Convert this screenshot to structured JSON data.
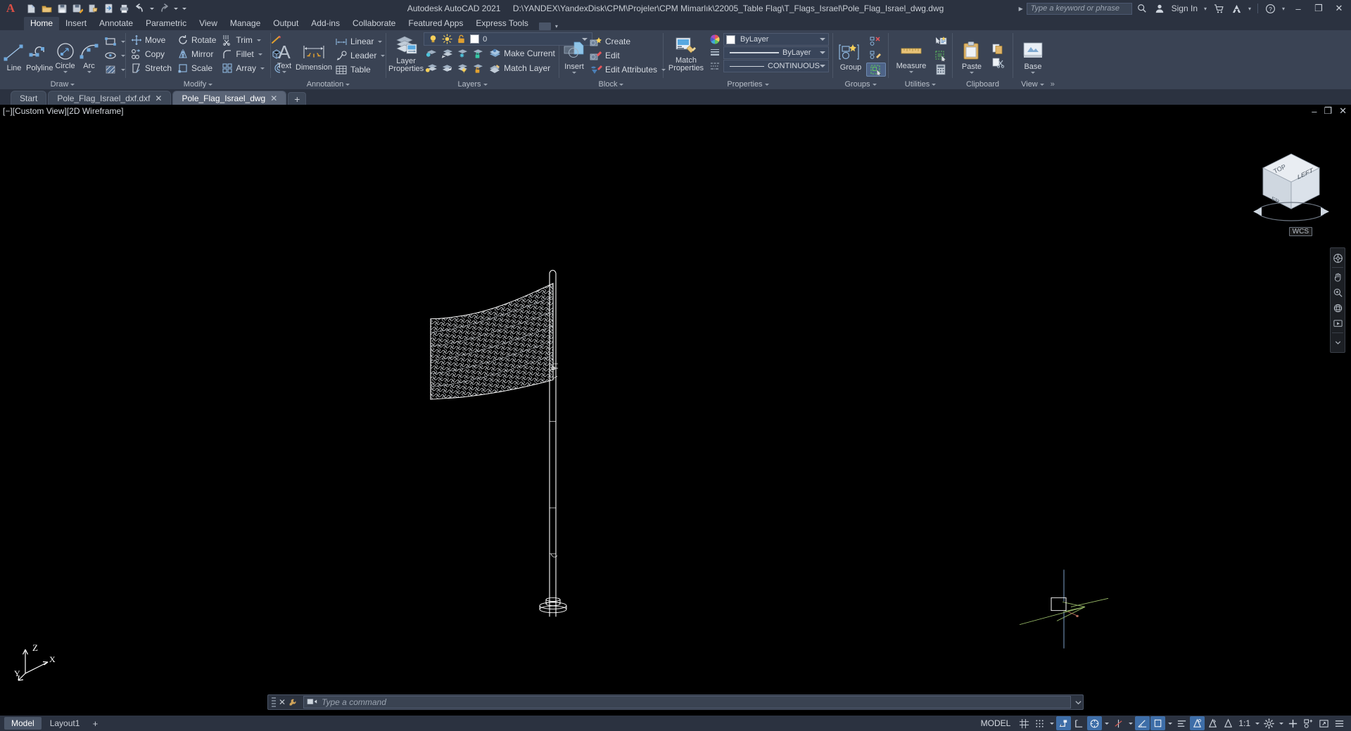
{
  "titlebar": {
    "app_title": "Autodesk AutoCAD 2021",
    "file_path": "D:\\YANDEX\\YandexDisk\\CPM\\Projeler\\CPM Mimarlık\\22005_Table Flag\\T_Flags_Israel\\Pole_Flag_Israel_dwg.dwg",
    "search_placeholder": "Type a keyword or phrase",
    "sign_in": "Sign In",
    "quick_access": [
      {
        "name": "new-file-icon",
        "label": "New"
      },
      {
        "name": "open-file-icon",
        "label": "Open"
      },
      {
        "name": "save-icon",
        "label": "Save"
      },
      {
        "name": "save-as-icon",
        "label": "Save As"
      },
      {
        "name": "export-icon",
        "label": "Export"
      },
      {
        "name": "cloud-sync-icon",
        "label": "Sync"
      },
      {
        "name": "print-icon",
        "label": "Plot"
      },
      {
        "name": "undo-icon",
        "label": "Undo"
      },
      {
        "name": "redo-icon",
        "label": "Redo"
      }
    ],
    "window_controls": {
      "minimize": "–",
      "restore": "❐",
      "close": "✕"
    }
  },
  "ribbon": {
    "tabs": [
      {
        "label": "Home",
        "active": true
      },
      {
        "label": "Insert",
        "active": false
      },
      {
        "label": "Annotate",
        "active": false
      },
      {
        "label": "Parametric",
        "active": false
      },
      {
        "label": "View",
        "active": false
      },
      {
        "label": "Manage",
        "active": false
      },
      {
        "label": "Output",
        "active": false
      },
      {
        "label": "Add-ins",
        "active": false
      },
      {
        "label": "Collaborate",
        "active": false
      },
      {
        "label": "Featured Apps",
        "active": false
      },
      {
        "label": "Express Tools",
        "active": false
      }
    ],
    "panels": {
      "draw": {
        "title": "Draw",
        "big": [
          {
            "label": "Line",
            "icon": "line-icon"
          },
          {
            "label": "Polyline",
            "icon": "polyline-icon"
          },
          {
            "label": "Circle",
            "icon": "circle-icon",
            "caret": true
          },
          {
            "label": "Arc",
            "icon": "arc-icon",
            "caret": true
          }
        ],
        "small": [
          {
            "label": "",
            "icon": "rectangle-icon",
            "caret": true
          },
          {
            "label": "",
            "icon": "ellipse-icon",
            "caret": true
          },
          {
            "label": "",
            "icon": "hatch-icon",
            "caret": true
          }
        ]
      },
      "modify": {
        "title": "Modify",
        "col1": [
          {
            "label": "Move",
            "icon": "move-icon"
          },
          {
            "label": "Copy",
            "icon": "copy-icon"
          },
          {
            "label": "Stretch",
            "icon": "stretch-icon"
          }
        ],
        "col2": [
          {
            "label": "Rotate",
            "icon": "rotate-icon"
          },
          {
            "label": "Mirror",
            "icon": "mirror-icon"
          },
          {
            "label": "Scale",
            "icon": "scale-icon"
          }
        ],
        "col3": [
          {
            "label": "Trim",
            "icon": "trim-icon",
            "caret": true
          },
          {
            "label": "Fillet",
            "icon": "fillet-icon",
            "caret": true
          },
          {
            "label": "Array",
            "icon": "array-icon",
            "caret": true
          }
        ],
        "col4": [
          {
            "label": "",
            "icon": "explode-icon"
          },
          {
            "label": "",
            "icon": "3d-solid-icon"
          },
          {
            "label": "",
            "icon": "offset-icon"
          }
        ]
      },
      "annotation": {
        "title": "Annotation",
        "big": [
          {
            "label": "Text",
            "icon": "text-icon",
            "caret": true
          },
          {
            "label": "Dimension",
            "icon": "dimension-icon"
          }
        ],
        "small": [
          {
            "label": "Linear",
            "icon": "linear-dim-icon",
            "caret": true
          },
          {
            "label": "Leader",
            "icon": "leader-icon",
            "caret": true
          },
          {
            "label": "Table",
            "icon": "table-icon"
          }
        ]
      },
      "layers": {
        "title": "Layers",
        "big_label": "Layer\nProperties",
        "big_line1": "Layer",
        "big_line2": "Properties",
        "current_layer": "0",
        "make_current": "Make Current",
        "match_layer": "Match Layer",
        "state_icons": [
          "lightbulb-on-icon",
          "sun-icon",
          "unlock-icon"
        ],
        "row_icons_1": [
          "layer-off-icon",
          "layer-isolate-icon",
          "layer-freeze-icon",
          "layer-lock-icon"
        ],
        "row_icons_2": [
          "layer-turn-on-icon",
          "layer-unisolate-icon",
          "layer-thaw-icon",
          "layer-unlock-icon"
        ]
      },
      "block": {
        "title": "Block",
        "big": [
          {
            "label": "Insert",
            "icon": "insert-block-icon",
            "caret": true
          }
        ],
        "small": [
          {
            "label": "Create",
            "icon": "create-block-icon"
          },
          {
            "label": "Edit",
            "icon": "edit-block-icon"
          },
          {
            "label": "Edit Attributes",
            "icon": "edit-attributes-icon",
            "caret": true
          }
        ]
      },
      "properties": {
        "title": "Properties",
        "big_line1": "Match",
        "big_line2": "Properties",
        "big_icon": "match-properties-icon",
        "combos": [
          {
            "icon": "color-wheel-icon",
            "value": "ByLayer",
            "type": "color"
          },
          {
            "icon": "lineweight-icon",
            "value": "ByLayer",
            "type": "lineweight"
          },
          {
            "icon": "linetype-icon",
            "value": "CONTINUOUS",
            "type": "linetype"
          }
        ]
      },
      "groups": {
        "title": "Groups",
        "big": [
          {
            "label": "Group",
            "icon": "group-icon"
          }
        ],
        "small": [
          {
            "label": "",
            "icon": "ungroup-icon"
          },
          {
            "label": "",
            "icon": "group-edit-icon"
          },
          {
            "label": "",
            "icon": "group-selection-on-icon"
          }
        ]
      },
      "utilities": {
        "title": "Utilities",
        "big": [
          {
            "label": "Measure",
            "icon": "measure-icon",
            "caret": true
          }
        ],
        "small": [
          {
            "label": "",
            "icon": "quick-select-icon"
          },
          {
            "label": "",
            "icon": "select-all-icon"
          },
          {
            "label": "",
            "icon": "calculator-icon"
          }
        ]
      },
      "clipboard": {
        "title": "Clipboard",
        "big": [
          {
            "label": "Paste",
            "icon": "paste-icon",
            "caret": true
          }
        ],
        "small": [
          {
            "label": "",
            "icon": "copy-clip-icon"
          },
          {
            "label": "",
            "icon": "cut-clip-icon"
          }
        ]
      },
      "view": {
        "title": "View",
        "big": [
          {
            "label": "Base",
            "icon": "base-view-icon",
            "caret": true
          }
        ],
        "overflow": "»"
      }
    }
  },
  "file_tabs": [
    {
      "label": "Start",
      "active": false,
      "closable": false
    },
    {
      "label": "Pole_Flag_Israel_dxf.dxf",
      "active": false,
      "closable": true
    },
    {
      "label": "Pole_Flag_Israel_dwg",
      "active": true,
      "closable": true
    }
  ],
  "file_tab_add": "+",
  "viewport": {
    "label_minimize": "[−]",
    "label_view": "[Custom View]",
    "label_visual_style": "[2D Wireframe]",
    "controls": {
      "minimize": "–",
      "maximize": "❐",
      "close": "✕"
    },
    "viewcube_faces": {
      "top": "TOP",
      "front": "FRONT",
      "right": "LEFT"
    },
    "wcs_label": "WCS"
  },
  "command_line": {
    "placeholder": "Type a command",
    "close": "✕"
  },
  "statusbar": {
    "layout_tabs": [
      {
        "label": "Model",
        "active": true
      },
      {
        "label": "Layout1",
        "active": false
      }
    ],
    "layout_add": "+",
    "model_button": "MODEL",
    "scale": "1:1",
    "toggles": [
      {
        "name": "grid-display-toggle",
        "on": false,
        "glyph": "grid"
      },
      {
        "name": "snap-mode-toggle",
        "on": false,
        "glyph": "snap"
      },
      {
        "name": "infer-constraints-toggle",
        "on": true,
        "glyph": "infer"
      },
      {
        "name": "dynamic-ucs-toggle",
        "on": false,
        "glyph": "ducs"
      },
      {
        "name": "object-snap-toggle",
        "on": true,
        "glyph": "osnap"
      },
      {
        "name": "ortho-mode-toggle",
        "on": false,
        "glyph": "ortho"
      },
      {
        "name": "polar-tracking-toggle",
        "on": true,
        "glyph": "polar"
      },
      {
        "name": "isometric-drafting-toggle",
        "on": true,
        "glyph": "iso"
      },
      {
        "name": "object-snap-tracking-toggle",
        "on": false,
        "glyph": "otrack"
      },
      {
        "name": "lineweight-toggle",
        "on": false,
        "glyph": "lwt"
      },
      {
        "name": "transparency-toggle",
        "on": true,
        "glyph": "transparency"
      },
      {
        "name": "selection-cycling-toggle",
        "on": false,
        "glyph": "cycling"
      },
      {
        "name": "annotation-visibility-toggle",
        "on": false,
        "glyph": "annvis"
      },
      {
        "name": "annotation-scale-toggle",
        "on": false,
        "glyph": "annscale"
      }
    ],
    "customization": "☰",
    "fullscreen": "⤢",
    "hardware_accel": "⚙"
  }
}
